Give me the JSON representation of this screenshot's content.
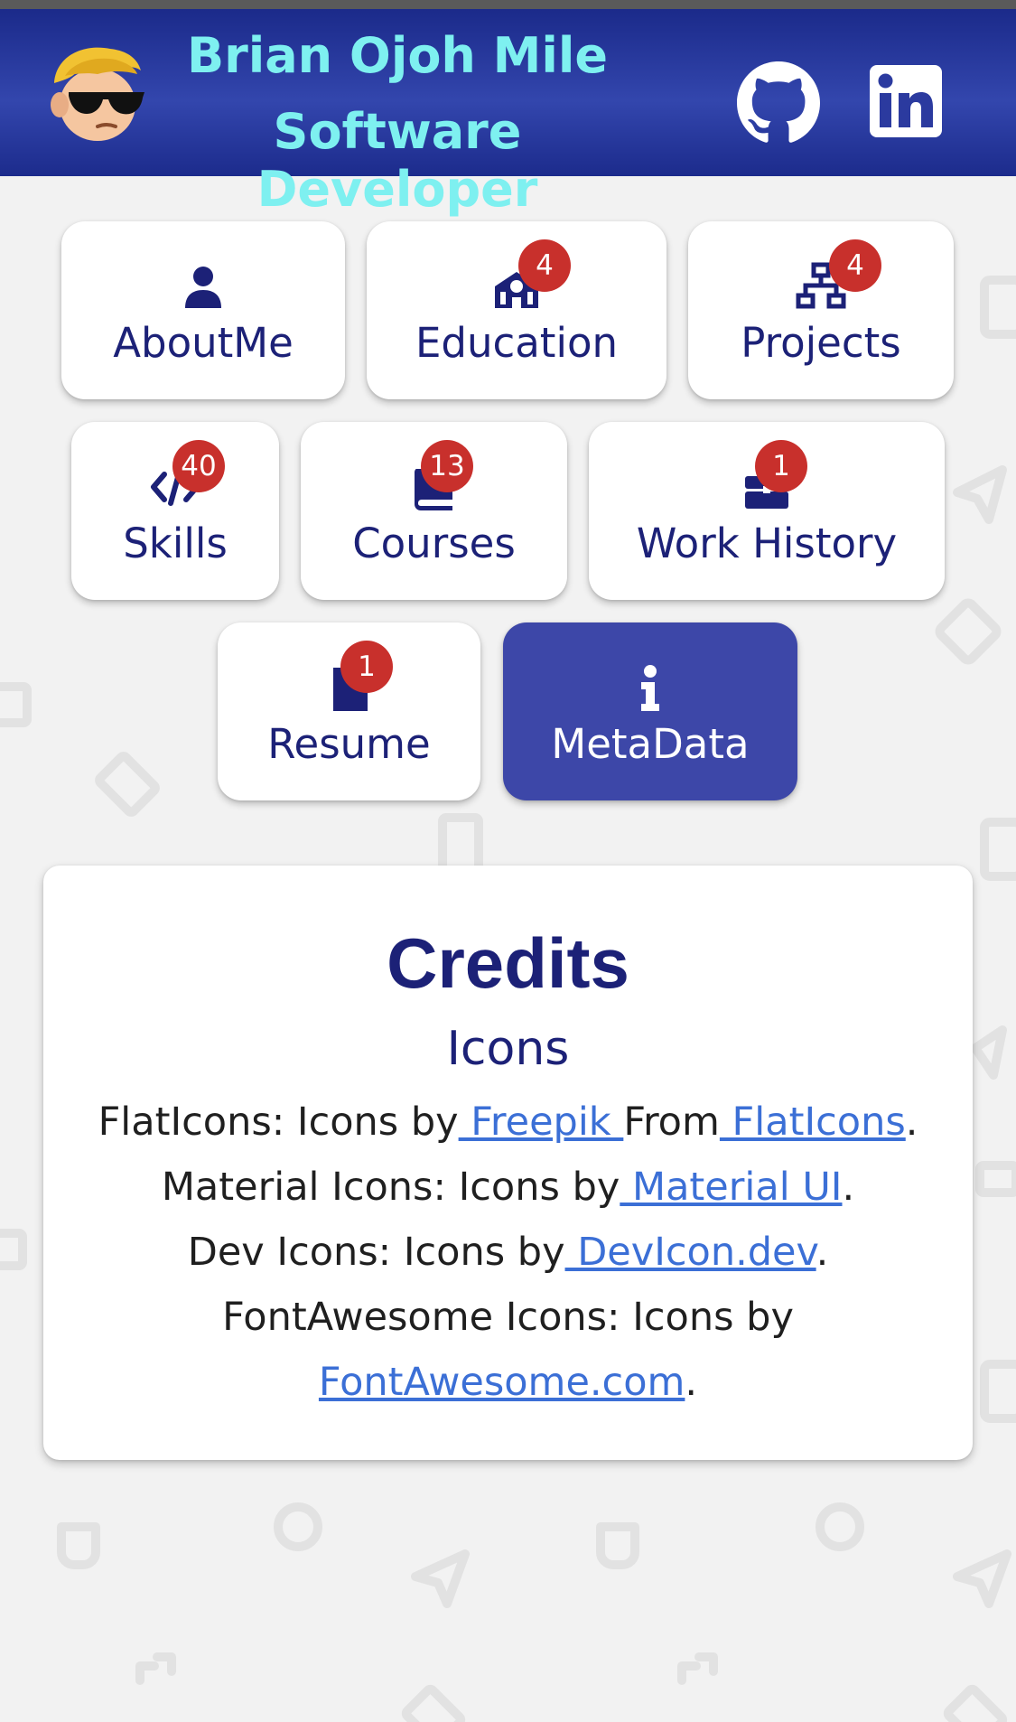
{
  "header": {
    "name": "Brian Ojoh Mile",
    "role": "Software Developer",
    "github_label": "github-icon",
    "linkedin_label": "linkedin-icon"
  },
  "nav": {
    "about": {
      "label": "AboutMe"
    },
    "education": {
      "label": "Education",
      "badge": "4"
    },
    "projects": {
      "label": "Projects",
      "badge": "4"
    },
    "skills": {
      "label": "Skills",
      "badge": "40"
    },
    "courses": {
      "label": "Courses",
      "badge": "13"
    },
    "work": {
      "label": "Work History",
      "badge": "1"
    },
    "resume": {
      "label": "Resume",
      "badge": "1"
    },
    "metadata": {
      "label": "MetaData",
      "active": true
    }
  },
  "credits": {
    "title": "Credits",
    "subtitle": "Icons",
    "flaticons": {
      "prefix": "FlatIcons: Icons by",
      "link1": " Freepik ",
      "mid": "From",
      "link2": " FlatIcons",
      "suffix": "."
    },
    "material": {
      "prefix": "Material Icons: Icons by",
      "link": " Material UI",
      "suffix": "."
    },
    "dev": {
      "prefix": "Dev Icons: Icons by",
      "link": " DevIcon.dev",
      "suffix": "."
    },
    "fontawesome": {
      "prefix": "FontAwesome Icons: Icons by",
      "link": "FontAwesome.com",
      "suffix": "."
    }
  },
  "colors": {
    "header": "#2a3a9e",
    "header_text": "#7ef0f0",
    "accent": "#3d47a8",
    "label": "#1c2177",
    "badge": "#c8302c",
    "link": "#3b6fd6"
  }
}
